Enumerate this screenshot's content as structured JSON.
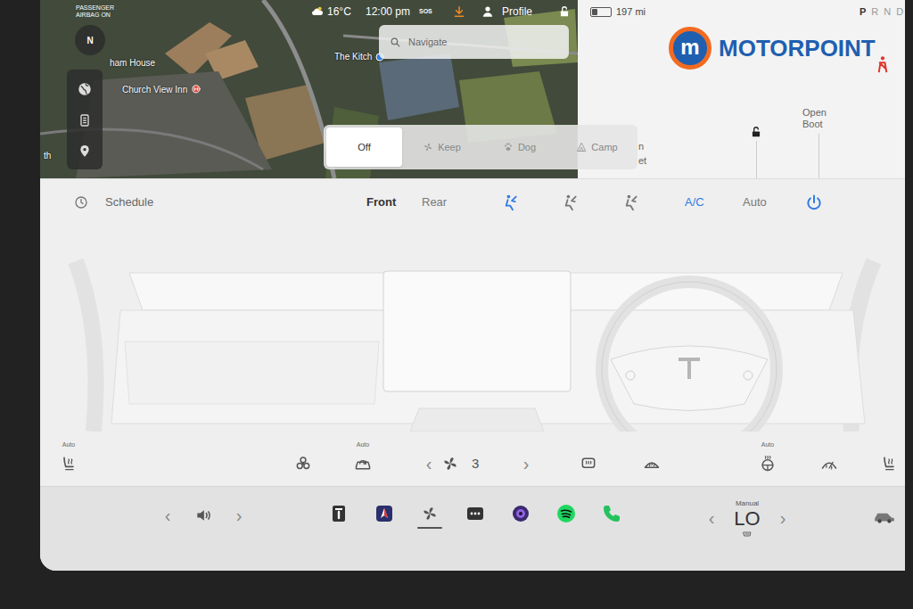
{
  "status_bar": {
    "airbag": [
      "PASSENGER",
      "AIRBAG ON"
    ],
    "temperature": "16°C",
    "time": "12:00 pm",
    "sos": "SOS",
    "profile": "Profile",
    "locked": false,
    "battery_level": 0.3,
    "range": "197 mi",
    "gears": [
      {
        "label": "P",
        "selected": true
      },
      {
        "label": "R",
        "selected": false
      },
      {
        "label": "N",
        "selected": false
      },
      {
        "label": "D",
        "selected": false
      }
    ]
  },
  "map": {
    "compass": "N",
    "labels": [
      "ham House",
      "Church View Inn",
      "The Kitch",
      "th"
    ]
  },
  "search": {
    "placeholder": "Navigate"
  },
  "climate_keeper": [
    {
      "label": "Off",
      "selected": true,
      "kind": "off"
    },
    {
      "label": "Keep",
      "selected": false,
      "kind": "keep"
    },
    {
      "label": "Dog",
      "selected": false,
      "kind": "dog"
    },
    {
      "label": "Camp",
      "selected": false,
      "kind": "camp"
    }
  ],
  "car_panel": {
    "boot": [
      "Open",
      "Boot"
    ],
    "bonnet": [
      "n",
      "et"
    ],
    "locked": false
  },
  "watermark": {
    "badge": "m",
    "name": "MOTORPOINT"
  },
  "climate": {
    "schedule": "Schedule",
    "zones": [
      {
        "label": "Front",
        "selected": true
      },
      {
        "label": "Rear",
        "selected": false
      }
    ],
    "airflow": [
      {
        "selected": true
      },
      {
        "selected": false
      },
      {
        "selected": false
      }
    ],
    "ac": {
      "label": "A/C",
      "on": true
    },
    "auto": {
      "label": "Auto",
      "on": false
    },
    "power": {
      "on": true
    },
    "controls": [
      {
        "kind": "seat-heat",
        "label": "Auto"
      },
      {
        "kind": "bioweapon"
      },
      {
        "kind": "recirculate",
        "label": "Auto"
      },
      {
        "kind": "fan",
        "prev": "‹",
        "speed": "3",
        "next": "›"
      },
      {
        "kind": "rear-defrost"
      },
      {
        "kind": "front-defrost"
      },
      {
        "kind": "wheel-heat",
        "label": "Auto"
      },
      {
        "kind": "wiper-heat"
      },
      {
        "kind": "seat-heat"
      }
    ]
  },
  "dock": {
    "volume": {
      "prev": "‹",
      "next": "›"
    },
    "apps": [
      {
        "kind": "manual",
        "selected": false
      },
      {
        "kind": "navigation",
        "selected": false
      },
      {
        "kind": "fan",
        "selected": true
      },
      {
        "kind": "more",
        "selected": false
      },
      {
        "kind": "camera",
        "selected": false
      },
      {
        "kind": "spotify",
        "selected": false
      },
      {
        "kind": "phone",
        "selected": false
      }
    ],
    "temperature": {
      "prev": "‹",
      "mode": "Manual",
      "value": "LO",
      "next": "›"
    }
  }
}
